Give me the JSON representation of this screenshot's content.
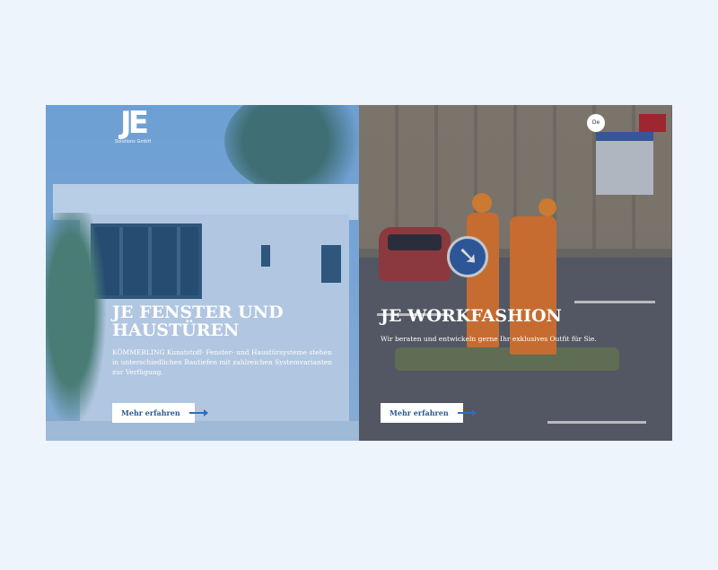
{
  "logo": {
    "mark": "JE",
    "subtitle": "Solutions GmbH"
  },
  "language": {
    "label": "De"
  },
  "panels": [
    {
      "title": "JE FENSTER UND HAUSTÜREN",
      "description": "KÖMMERLING Kunststoff- Fenster- und Haustürsysteme stehen in unterschiedlichen Bautiefen mit zahlreichen Systemvarianten zur Verfügung.",
      "cta": "Mehr erfahren"
    },
    {
      "title": "JE WORKFASHION",
      "description": "Wir beraten und entwickeln gerne Ihr exklusives Outfit für Sie.",
      "cta": "Mehr erfahren"
    }
  ],
  "colors": {
    "accent": "#2d6fb5",
    "page_background": "#eef4fb"
  }
}
